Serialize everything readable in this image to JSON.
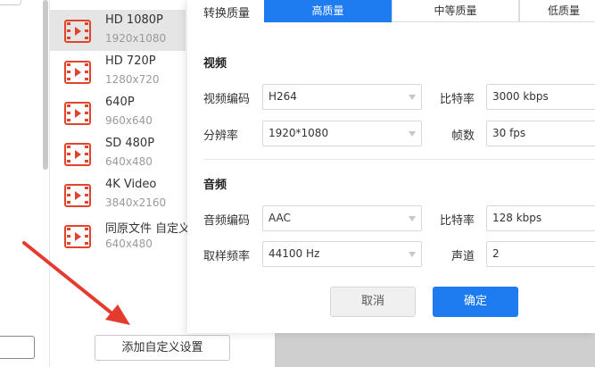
{
  "presets": [
    {
      "name": "HD 1080P",
      "res": "1920x1080",
      "selected": true
    },
    {
      "name": "HD 720P",
      "res": "1280x720",
      "selected": false
    },
    {
      "name": "640P",
      "res": "960x640",
      "selected": false
    },
    {
      "name": "SD 480P",
      "res": "640x480",
      "selected": false
    },
    {
      "name": "4K Video",
      "res": "3840x2160",
      "selected": false
    },
    {
      "name": "同原文件 自定义",
      "res": "640x480",
      "selected": false
    }
  ],
  "add_custom_label": "添加自定义设置",
  "dialog": {
    "quality_label": "转换质量",
    "quality_tabs": [
      "高质量",
      "中等质量",
      "低质量"
    ],
    "video_section": "视频",
    "video_codec_label": "视频编码",
    "video_codec_value": "H264",
    "video_bitrate_label": "比特率",
    "video_bitrate_value": "3000 kbps",
    "resolution_label": "分辨率",
    "resolution_value": "1920*1080",
    "fps_label": "帧数",
    "fps_value": "30 fps",
    "audio_section": "音频",
    "audio_codec_label": "音频编码",
    "audio_codec_value": "AAC",
    "audio_bitrate_label": "比特率",
    "audio_bitrate_value": "128 kbps",
    "sample_rate_label": "取样频率",
    "sample_rate_value": "44100 Hz",
    "channels_label": "声道",
    "channels_value": "2",
    "cancel_label": "取消",
    "ok_label": "确定"
  },
  "colors": {
    "accent": "#1e7cf0",
    "icon_red": "#e0452b",
    "annotation": "#e53a2e"
  }
}
